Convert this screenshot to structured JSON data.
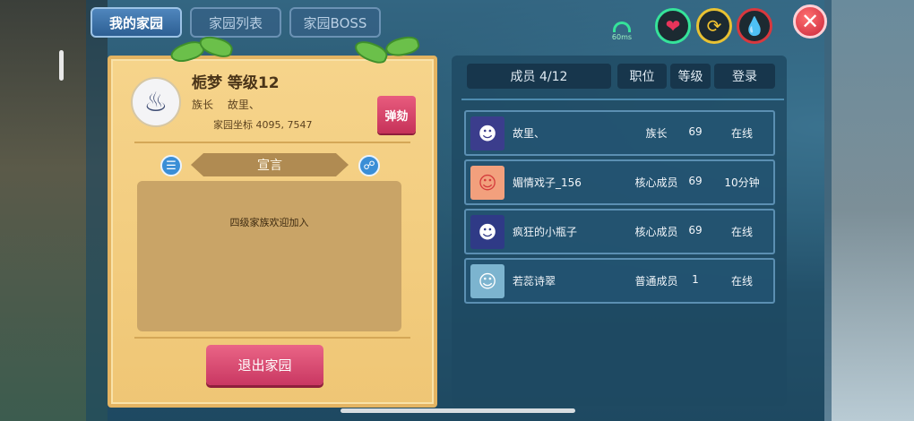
{
  "tabs": [
    {
      "label": "我的家园"
    },
    {
      "label": "家园列表"
    },
    {
      "label": "家园BOSS"
    }
  ],
  "status": {
    "ping": "60ms",
    "icons": [
      "heart-icon",
      "refresh-icon",
      "water-drop-icon"
    ]
  },
  "family": {
    "name_level": "栀梦 等级12",
    "leader_label": "族长",
    "leader_name": "故里、",
    "coord_label": "家园坐标",
    "coords": "4095, 7547",
    "impeach_label": "弹劾",
    "declaration_title": "宣言",
    "declaration_text": "四级家族欢迎加入",
    "exit_label": "退出家园"
  },
  "members": {
    "headers": {
      "member": "成员 4/12",
      "position": "职位",
      "level": "等级",
      "login": "登录"
    },
    "rows": [
      {
        "name": "故里、",
        "position": "族长",
        "level": "69",
        "login": "在线"
      },
      {
        "name": "媚情戏子_156",
        "position": "核心成员",
        "level": "69",
        "login": "10分钟"
      },
      {
        "name": "疯狂的小瓶子",
        "position": "核心成员",
        "level": "69",
        "login": "在线"
      },
      {
        "name": "若蕊诗翠",
        "position": "普通成员",
        "level": "1",
        "login": "在线"
      }
    ]
  },
  "colors": {
    "accent_pink": "#d9406b",
    "parchment": "#f3cf82",
    "online_green": "#35e39a"
  }
}
